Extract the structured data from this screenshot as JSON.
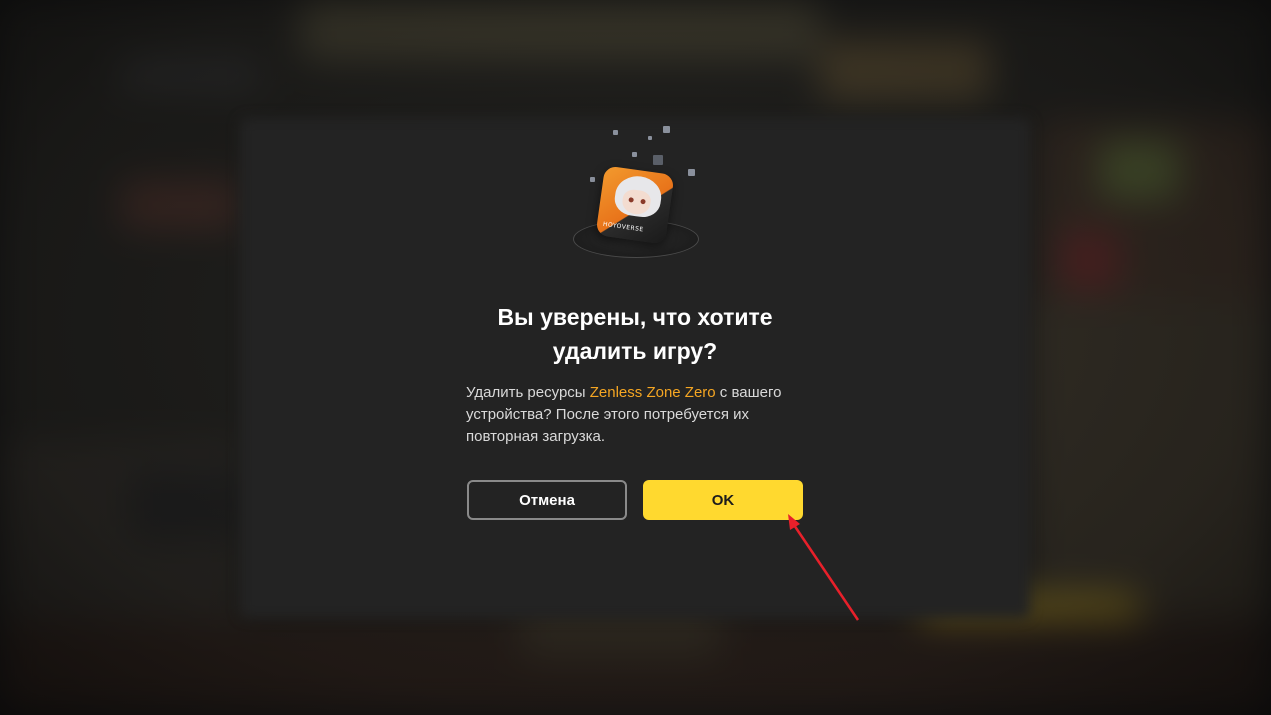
{
  "dialog": {
    "title_line1": "Вы уверены, что хотите",
    "title_line2": "удалить игру?",
    "desc_before": "Удалить ресурсы ",
    "game_name": "Zenless Zone Zero",
    "desc_after": " с вашего устройства? После этого потребуется их повторная загрузка.",
    "cancel_label": "Отмена",
    "ok_label": "OK",
    "game_icon_brand": "HOYOVERSE"
  },
  "colors": {
    "accent_yellow": "#ffd92f",
    "game_name_orange": "#f5a623",
    "annotation_arrow": "#e8202a"
  },
  "icons": [
    "game-icon-zenless-zone-zero",
    "annotation-arrow-icon"
  ]
}
